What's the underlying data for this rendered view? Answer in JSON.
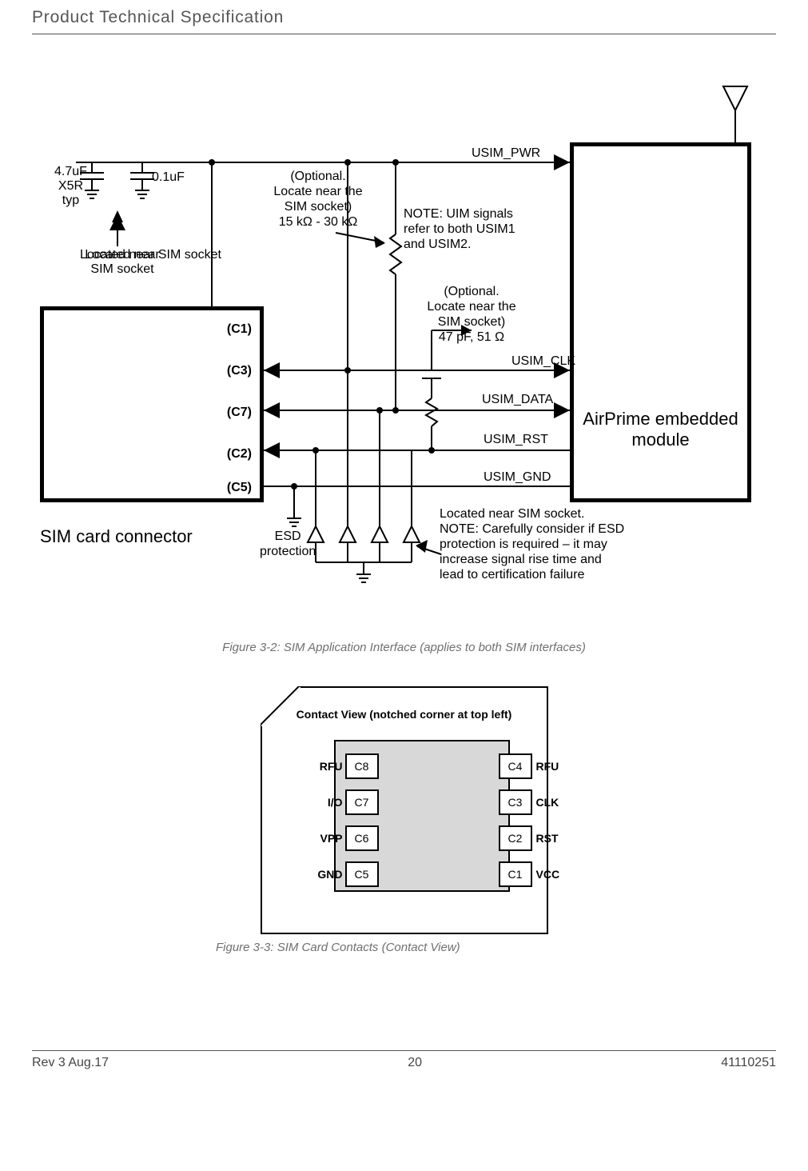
{
  "header": {
    "title": "Product Technical Specification"
  },
  "diagram": {
    "module_name": "AirPrime embedded module",
    "sim_connector_label": "SIM card connector",
    "sim_pins": {
      "c1": "(C1)",
      "c3": "(C3)",
      "c7": "(C7)",
      "c2": "(C2)",
      "c5": "(C5)"
    },
    "signals": {
      "pwr": "USIM_PWR",
      "clk": "USIM_CLK",
      "data": "USIM_DATA",
      "rst": "USIM_RST",
      "gnd": "USIM_GND"
    },
    "cap1": {
      "val": "4.7uF",
      "type": "X5R",
      "typ": "typ"
    },
    "cap2": {
      "val": "0.1uF"
    },
    "located_near": "Located near SIM socket",
    "optional1": {
      "l1": "(Optional.",
      "l2": "Locate near the",
      "l3": "SIM socket)",
      "l4": "15 kΩ - 30 kΩ"
    },
    "optional2": {
      "l1": "(Optional.",
      "l2": "Locate near the",
      "l3": "SIM socket)",
      "l4": "47 pF, 51 Ω"
    },
    "uim_note": {
      "l1": "NOTE: UIM signals",
      "l2": "refer to both USIM1",
      "l3": "and USIM2."
    },
    "esd_label": {
      "l1": "ESD",
      "l2": "protection"
    },
    "esd_note": {
      "l1": "Located near SIM socket.",
      "l2": "NOTE: Carefully consider if ESD",
      "l3": "protection is required – it may",
      "l4": "increase signal rise time and",
      "l5": "lead to certification failure"
    }
  },
  "fig32_caption": "Figure 3-2:  SIM Application Interface (applies to both SIM interfaces)",
  "sim_contacts": {
    "title": "Contact View (notched corner at top left)",
    "rows": [
      {
        "left_label": "RFU",
        "left_pin": "C8",
        "right_pin": "C4",
        "right_label": "RFU"
      },
      {
        "left_label": "I/O",
        "left_pin": "C7",
        "right_pin": "C3",
        "right_label": "CLK"
      },
      {
        "left_label": "VPP",
        "left_pin": "C6",
        "right_pin": "C2",
        "right_label": "RST"
      },
      {
        "left_label": "GND",
        "left_pin": "C5",
        "right_pin": "C1",
        "right_label": "VCC"
      }
    ]
  },
  "fig33_caption": "Figure 3-3:  SIM Card Contacts (Contact View)",
  "footer": {
    "left": "Rev 3  Aug.17",
    "center": "20",
    "right": "41110251"
  }
}
